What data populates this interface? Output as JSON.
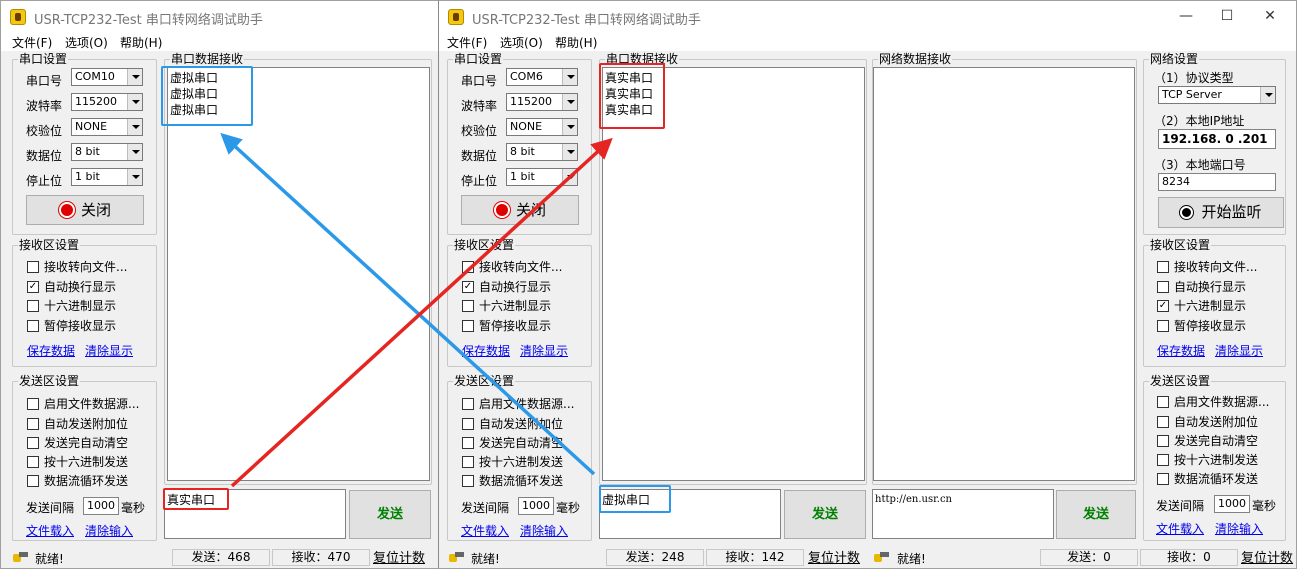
{
  "app_title": "USR-TCP232-Test 串口转网络调试助手",
  "menu": [
    "文件(F)",
    "选项(O)",
    "帮助(H)"
  ],
  "window_controls": [
    "—",
    "☐",
    "✕"
  ],
  "serial_settings": {
    "title": "串口设置",
    "port_label": "串口号",
    "baud_label": "波特率",
    "parity_label": "校验位",
    "databits_label": "数据位",
    "stopbits_label": "停止位",
    "baud": "115200",
    "parity": "NONE",
    "databits": "8 bit",
    "stopbits": "1 bit",
    "close_label": "关闭"
  },
  "recv_settings": {
    "title": "接收区设置",
    "options": [
      "接收转向文件...",
      "自动换行显示",
      "十六进制显示",
      "暂停接收显示"
    ],
    "save_link": "保存数据",
    "clear_link": "清除显示"
  },
  "send_settings": {
    "title": "发送区设置",
    "options": [
      "启用文件数据源...",
      "自动发送附加位",
      "发送完自动清空",
      "按十六进制发送",
      "数据流循环发送"
    ],
    "interval_label": "发送间隔",
    "interval_value": "1000",
    "interval_unit": "毫秒",
    "load_link": "文件载入",
    "clear_link": "清除输入"
  },
  "serial_recv_title": "串口数据接收",
  "send_button": "发送",
  "status_ready": "就绪!",
  "reset_label": "复位计数",
  "window1": {
    "port": "COM10",
    "recv_lines": [
      "虚拟串口",
      "虚拟串口",
      "虚拟串口"
    ],
    "send_text": "真实串口",
    "sent": "发送：468",
    "recv": "接收：470"
  },
  "window2": {
    "port": "COM6",
    "recv_lines": [
      "真实串口",
      "真实串口",
      "真实串口"
    ],
    "send_text": "虚拟串口",
    "sent": "发送：248",
    "recv": "接收：142",
    "net_recv_title": "网络数据接收",
    "net_send_text": "http://en.usr.cn",
    "net_sent": "发送：0",
    "net_recv": "接收：0",
    "network": {
      "title": "网络设置",
      "protocol_label": "（1）协议类型",
      "protocol": "TCP Server",
      "ip_label": "（2）本地IP地址",
      "ip": "192.168. 0 .201",
      "port_label": "（3）本地端口号",
      "port": "8234",
      "listen_label": "开始监听"
    },
    "net_recv_options_checked": [
      false,
      false,
      true,
      false
    ]
  },
  "colors": {
    "red_highlight": "#e52521",
    "blue_highlight": "#2b98e8",
    "send_green": "#008000",
    "link_blue": "#0000ee"
  }
}
